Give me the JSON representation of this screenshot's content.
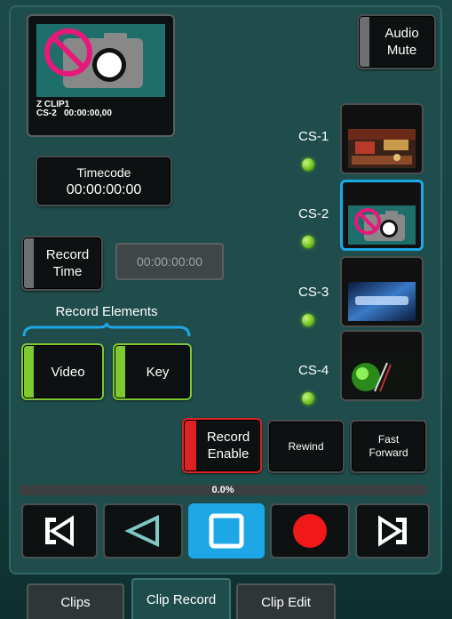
{
  "preview": {
    "clip_name": "Z CLIP1",
    "channel": "CS-2",
    "timecode": "00:00:00,00"
  },
  "audio_mute": {
    "line1": "Audio",
    "line2": "Mute"
  },
  "timecode_display": {
    "label": "Timecode",
    "value": "00:00:00:00"
  },
  "record_time": {
    "line1": "Record",
    "line2": "Time",
    "field_value": "00:00:00:00"
  },
  "record_elements": {
    "title": "Record Elements",
    "video_label": "Video",
    "key_label": "Key"
  },
  "sources": [
    {
      "label": "CS-1",
      "thumb": "studio-set-image"
    },
    {
      "label": "CS-2",
      "thumb": "no-camera-icon",
      "selected": true
    },
    {
      "label": "CS-3",
      "thumb": "logo-image"
    },
    {
      "label": "CS-4",
      "thumb": "green-orb-image"
    }
  ],
  "actions": {
    "record_enable": {
      "line1": "Record",
      "line2": "Enable"
    },
    "rewind": "Rewind",
    "fast_forward": {
      "line1": "Fast",
      "line2": "Forward"
    }
  },
  "progress": {
    "text": "0.0%",
    "value": 0.0
  },
  "transport": [
    "go-to-start-icon",
    "play-reverse-icon",
    "stop-icon",
    "record-icon",
    "go-to-end-icon"
  ],
  "tabs": [
    {
      "label": "Clips",
      "active": false
    },
    {
      "label": "Clip Record",
      "active": true
    },
    {
      "label": "Clip Edit",
      "active": false
    }
  ],
  "colors": {
    "accent_green": "#7ec832",
    "record_red": "#e02121",
    "selected_blue": "#1ea7e6",
    "no_camera_pink": "#e6197a"
  }
}
